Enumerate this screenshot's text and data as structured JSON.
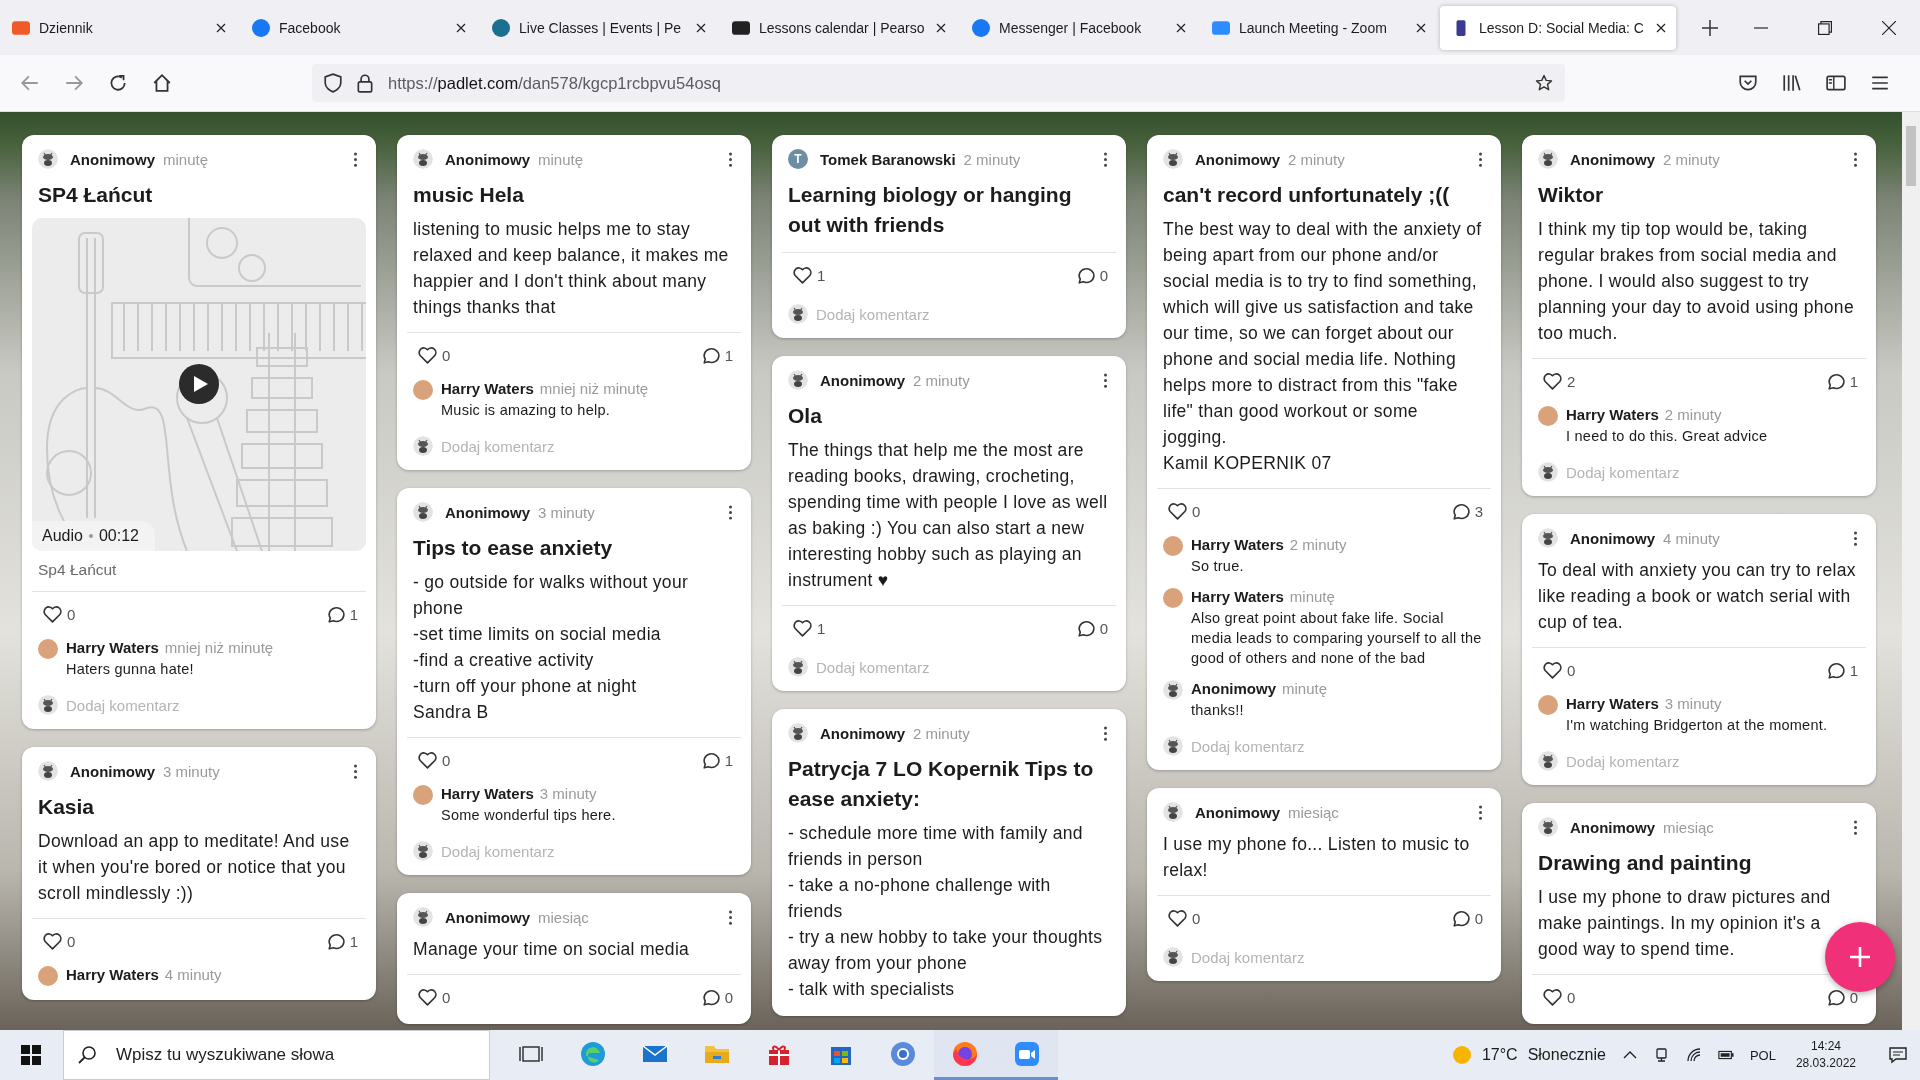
{
  "browser": {
    "tabs": [
      {
        "title": "Dziennik",
        "selected": false
      },
      {
        "title": "Facebook",
        "selected": false
      },
      {
        "title": "Live Classes | Events | Pe",
        "selected": false
      },
      {
        "title": "Lessons calendar | Pearso",
        "selected": false
      },
      {
        "title": "Messenger | Facebook",
        "selected": false
      },
      {
        "title": "Launch Meeting - Zoom",
        "selected": false
      },
      {
        "title": "Lesson D: Social Media: C",
        "selected": true
      }
    ],
    "url": {
      "scheme": "https://",
      "host": "padlet.com",
      "path": "/dan578/kgcp1rcbpvu54osq"
    }
  },
  "board": {
    "columns": [
      {
        "posts": [
          {
            "author": "Anonimowy",
            "time": "minutę",
            "title": "SP4 Łańcut",
            "attachment": {
              "kind": "audio",
              "label": "Audio",
              "duration": "00:12",
              "caption": "Sp4 Łańcut"
            },
            "likes": "0",
            "comment_count": "1",
            "comments": [
              {
                "kind": "photo",
                "author": "Harry Waters",
                "time": "mniej niż minutę",
                "text": "Haters gunna hate!"
              }
            ],
            "add_comment": "Dodaj komentarz"
          },
          {
            "author": "Anonimowy",
            "time": "3 minuty",
            "title": "Kasia",
            "body": "Download an app to meditate! And use it when you're bored or notice that you scroll mindlessly :))",
            "likes": "0",
            "comment_count": "1",
            "comments": [
              {
                "kind": "photo",
                "author": "Harry Waters",
                "time": "4 minuty"
              }
            ]
          }
        ]
      },
      {
        "posts": [
          {
            "author": "Anonimowy",
            "time": "minutę",
            "title": "music Hela",
            "body": "listening to music helps me to stay relaxed and keep balance, it makes me happier and I don't think about many things thanks that",
            "likes": "0",
            "comment_count": "1",
            "comments": [
              {
                "kind": "photo",
                "author": "Harry Waters",
                "time": "mniej niż minutę",
                "text": "Music is amazing to help."
              }
            ],
            "add_comment": "Dodaj komentarz"
          },
          {
            "author": "Anonimowy",
            "time": "3 minuty",
            "title": "Tips to ease anxiety",
            "body": "- go outside for walks without your phone\n-set time limits on social media\n-find a creative activity\n-turn off your phone at night\nSandra B",
            "likes": "0",
            "comment_count": "1",
            "comments": [
              {
                "kind": "photo",
                "author": "Harry Waters",
                "time": "3 minuty",
                "text": "Some wonderful tips here."
              }
            ],
            "add_comment": "Dodaj komentarz"
          },
          {
            "author": "Anonimowy",
            "time": "miesiąc",
            "body": "Manage your time on social media",
            "likes": "0",
            "comment_count": "0"
          }
        ]
      },
      {
        "posts": [
          {
            "author": "Tomek Baranowski",
            "initial": "T",
            "time": "2 minuty",
            "title": "Learning biology or hanging out with friends",
            "likes": "1",
            "comment_count": "0",
            "add_comment": "Dodaj komentarz"
          },
          {
            "author": "Anonimowy",
            "time": "2 minuty",
            "title": "Ola",
            "body": "The things that help me the most are reading books, drawing, crocheting, spending time with people I love as well as baking :) You can also start a new interesting hobby such as playing an instrument ♥",
            "likes": "1",
            "comment_count": "0",
            "add_comment": "Dodaj komentarz"
          },
          {
            "author": "Anonimowy",
            "time": "2 minuty",
            "title": "Patrycja 7 LO Kopernik Tips to ease anxiety:",
            "body": "- schedule more time with family and friends in person\n- take a no-phone challenge with friends\n- try a new hobby to take your thoughts away from your phone\n- talk with specialists"
          }
        ]
      },
      {
        "posts": [
          {
            "author": "Anonimowy",
            "time": "2 minuty",
            "title": "can't record unfortunately ;((",
            "body": "The best way to deal with the anxiety of being apart from our phone and/or social media is to try to find something, which will give us satisfaction and take our time, so we can forget about our phone and social media life. Nothing helps more to distract from this \"fake life\" than good workout or some jogging.\nKamil KOPERNIK 07",
            "likes": "0",
            "comment_count": "3",
            "comments": [
              {
                "kind": "photo",
                "author": "Harry Waters",
                "time": "2 minuty",
                "text": "So true."
              },
              {
                "kind": "photo",
                "author": "Harry Waters",
                "time": "minutę",
                "text": "Also great point about fake life. Social media leads to comparing yourself to all the good of others and none of the bad"
              },
              {
                "kind": "anonymous",
                "author": "Anonimowy",
                "time": "minutę",
                "text": "thanks!!"
              }
            ],
            "add_comment": "Dodaj komentarz"
          },
          {
            "author": "Anonimowy",
            "time": "miesiąc",
            "body": "I use my phone fo... Listen to music to relax!",
            "likes": "0",
            "comment_count": "0",
            "add_comment": "Dodaj komentarz"
          }
        ]
      },
      {
        "posts": [
          {
            "author": "Anonimowy",
            "time": "2 minuty",
            "title": "Wiktor",
            "body": "I think my tip top would be, taking regular brakes from social media and phone. I would also suggest to try planning your day to avoid using phone too much.",
            "likes": "2",
            "comment_count": "1",
            "comments": [
              {
                "kind": "photo",
                "author": "Harry Waters",
                "time": "2 minuty",
                "text": "I need to do this. Great advice"
              }
            ],
            "add_comment": "Dodaj komentarz"
          },
          {
            "author": "Anonimowy",
            "time": "4 minuty",
            "body": "To deal with anxiety you can try to relax like reading a book or watch serial with cup of tea.",
            "likes": "0",
            "comment_count": "1",
            "comments": [
              {
                "kind": "photo",
                "author": "Harry Waters",
                "time": "3 minuty",
                "text": "I'm watching Bridgerton at the moment."
              }
            ],
            "add_comment": "Dodaj komentarz"
          },
          {
            "author": "Anonimowy",
            "time": "miesiąc",
            "title": "Drawing and painting",
            "body": "I use my phone to draw pictures and make paintings. In my opinion it's a good way to spend time.",
            "likes": "0",
            "comment_count": "0"
          }
        ]
      }
    ]
  },
  "taskbar": {
    "search_placeholder": "Wpisz tu wyszukiwane słowa",
    "apps": [
      {
        "kind": "taskview",
        "running": false
      },
      {
        "kind": "edge",
        "running": false
      },
      {
        "kind": "mail",
        "running": false
      },
      {
        "kind": "folder",
        "running": false
      },
      {
        "kind": "gift",
        "running": false
      },
      {
        "kind": "store",
        "running": false
      },
      {
        "kind": "circle",
        "running": false
      },
      {
        "kind": "firefox",
        "running": true
      },
      {
        "kind": "zoom",
        "running": true
      }
    ],
    "temperature": "17°C",
    "weather": "Słonecznie",
    "language": "POL",
    "time": "14:24",
    "date": "28.03.2022"
  }
}
